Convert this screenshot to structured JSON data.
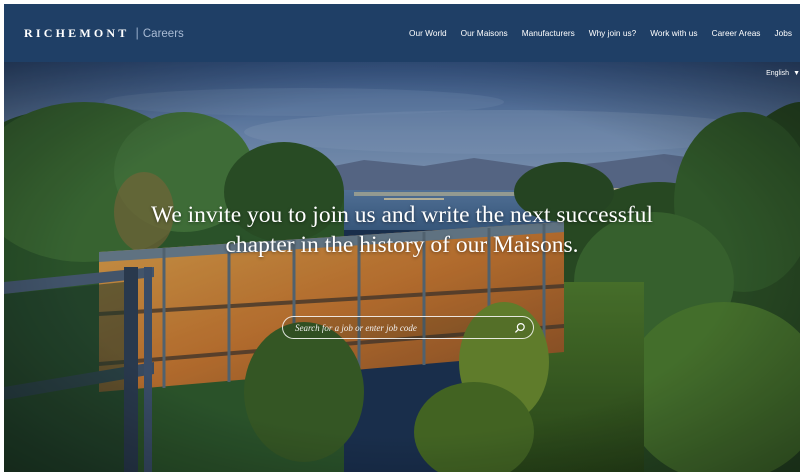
{
  "header": {
    "brand_name": "Richemont",
    "brand_separator": "|",
    "brand_subtitle": "Careers",
    "nav": [
      {
        "label": "Our World"
      },
      {
        "label": "Our Maisons"
      },
      {
        "label": "Manufacturers"
      },
      {
        "label": "Why join us?"
      },
      {
        "label": "Work with us"
      },
      {
        "label": "Career Areas"
      },
      {
        "label": "Jobs"
      }
    ],
    "background_color": "#1f3f66"
  },
  "language": {
    "selected": "English",
    "icon": "chevron-down-icon"
  },
  "hero": {
    "headline": "We invite you to join us and write the next successful chapter in the history of our Maisons.",
    "search": {
      "placeholder": "Search for a job or enter job code",
      "value": "",
      "icon": "search-icon"
    }
  }
}
